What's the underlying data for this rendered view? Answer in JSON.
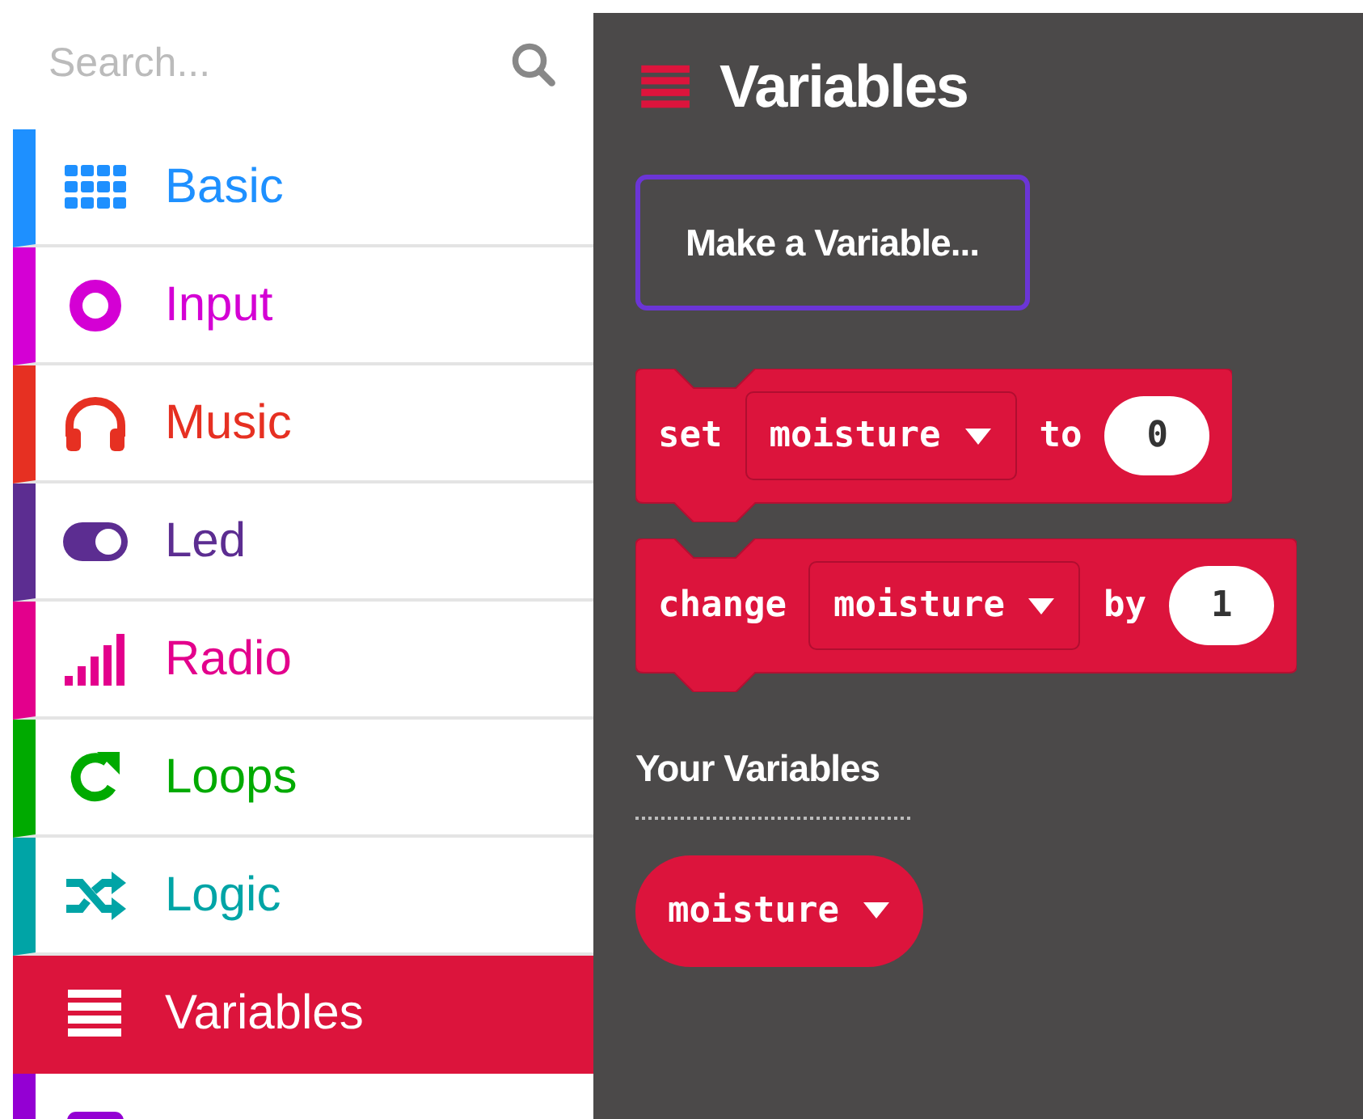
{
  "search": {
    "placeholder": "Search..."
  },
  "sidebar": {
    "items": [
      {
        "label": "Basic",
        "kind": "grid",
        "color": "#1e90ff",
        "selected": false
      },
      {
        "label": "Input",
        "kind": "ring",
        "color": "#d400d4",
        "selected": false
      },
      {
        "label": "Music",
        "kind": "headphones",
        "color": "#e63022",
        "selected": false
      },
      {
        "label": "Led",
        "kind": "toggle",
        "color": "#5c2d91",
        "selected": false
      },
      {
        "label": "Radio",
        "kind": "signal",
        "color": "#e3008c",
        "selected": false
      },
      {
        "label": "Loops",
        "kind": "loop",
        "color": "#00aa00",
        "selected": false
      },
      {
        "label": "Logic",
        "kind": "shuffle",
        "color": "#00a4a6",
        "selected": false
      },
      {
        "label": "Variables",
        "kind": "stripes",
        "color": "#dc143c",
        "selected": true
      },
      {
        "kind": "square",
        "color": "#9400d3",
        "selected": false
      }
    ]
  },
  "flyout": {
    "title": "Variables",
    "button": "Make a Variable...",
    "blocks": [
      {
        "parts": [
          {
            "kind": "keyword",
            "text": "set"
          },
          {
            "kind": "dropdown",
            "text": "moisture"
          },
          {
            "kind": "keyword",
            "text": "to"
          },
          {
            "kind": "number",
            "text": "0"
          }
        ]
      },
      {
        "parts": [
          {
            "kind": "keyword",
            "text": "change"
          },
          {
            "kind": "dropdown",
            "text": "moisture"
          },
          {
            "kind": "keyword",
            "text": "by"
          },
          {
            "kind": "number",
            "text": "1"
          }
        ]
      }
    ],
    "section_label": "Your Variables",
    "variables": [
      {
        "name": "moisture"
      }
    ]
  }
}
